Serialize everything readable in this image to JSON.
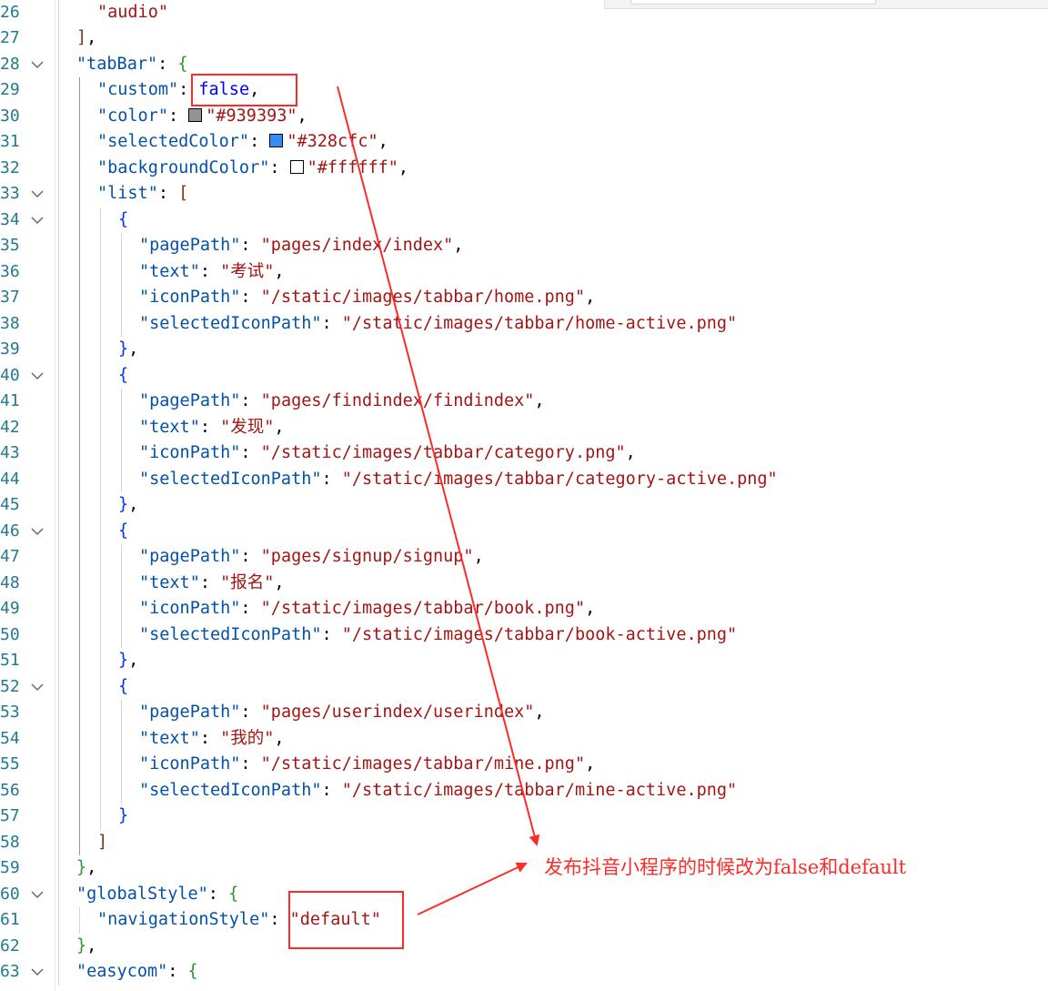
{
  "editor": {
    "lines": [
      {
        "number": "26",
        "fold": false,
        "tokens": [
          {
            "t": "\"audio\"",
            "c": "str"
          }
        ]
      },
      {
        "number": "27",
        "fold": false,
        "tokens": [
          {
            "t": "]",
            "c": "br3"
          },
          {
            "t": ",",
            "c": "pun"
          }
        ]
      },
      {
        "number": "28",
        "fold": true,
        "tokens": [
          {
            "t": "\"tabBar\"",
            "c": "key"
          },
          {
            "t": ": ",
            "c": "pun"
          },
          {
            "t": "{",
            "c": "br1"
          }
        ]
      },
      {
        "number": "29",
        "fold": false,
        "tokens": [
          {
            "t": "\"custom\"",
            "c": "key"
          },
          {
            "t": ": ",
            "c": "pun"
          },
          {
            "t": "false",
            "c": "kw"
          },
          {
            "t": ",",
            "c": "pun"
          }
        ]
      },
      {
        "number": "30",
        "fold": false,
        "tokens": [
          {
            "t": "\"color\"",
            "c": "key"
          },
          {
            "t": ": ",
            "c": "pun"
          },
          {
            "swatch": "#939393"
          },
          {
            "t": "\"#939393\"",
            "c": "str"
          },
          {
            "t": ",",
            "c": "pun"
          }
        ]
      },
      {
        "number": "31",
        "fold": false,
        "tokens": [
          {
            "t": "\"selectedColor\"",
            "c": "key"
          },
          {
            "t": ": ",
            "c": "pun"
          },
          {
            "swatch": "#328cfc"
          },
          {
            "t": "\"#328cfc\"",
            "c": "str"
          },
          {
            "t": ",",
            "c": "pun"
          }
        ]
      },
      {
        "number": "32",
        "fold": false,
        "tokens": [
          {
            "t": "\"backgroundColor\"",
            "c": "key"
          },
          {
            "t": ": ",
            "c": "pun"
          },
          {
            "swatch": "#ffffff"
          },
          {
            "t": "\"#ffffff\"",
            "c": "str"
          },
          {
            "t": ",",
            "c": "pun"
          }
        ]
      },
      {
        "number": "33",
        "fold": true,
        "tokens": [
          {
            "t": "\"list\"",
            "c": "key"
          },
          {
            "t": ": ",
            "c": "pun"
          },
          {
            "t": "[",
            "c": "br3"
          }
        ]
      },
      {
        "number": "34",
        "fold": true,
        "tokens": [
          {
            "t": "{",
            "c": "br2"
          }
        ]
      },
      {
        "number": "35",
        "fold": false,
        "tokens": [
          {
            "t": "\"pagePath\"",
            "c": "key"
          },
          {
            "t": ": ",
            "c": "pun"
          },
          {
            "t": "\"pages/index/index\"",
            "c": "str"
          },
          {
            "t": ",",
            "c": "pun"
          }
        ]
      },
      {
        "number": "36",
        "fold": false,
        "tokens": [
          {
            "t": "\"text\"",
            "c": "key"
          },
          {
            "t": ": ",
            "c": "pun"
          },
          {
            "t": "\"考试\"",
            "c": "str"
          },
          {
            "t": ",",
            "c": "pun"
          }
        ]
      },
      {
        "number": "37",
        "fold": false,
        "tokens": [
          {
            "t": "\"iconPath\"",
            "c": "key"
          },
          {
            "t": ": ",
            "c": "pun"
          },
          {
            "t": "\"/static/images/tabbar/home.png\"",
            "c": "str"
          },
          {
            "t": ",",
            "c": "pun"
          }
        ]
      },
      {
        "number": "38",
        "fold": false,
        "tokens": [
          {
            "t": "\"selectedIconPath\"",
            "c": "key"
          },
          {
            "t": ": ",
            "c": "pun"
          },
          {
            "t": "\"/static/images/tabbar/home-active.png\"",
            "c": "str"
          }
        ]
      },
      {
        "number": "39",
        "fold": false,
        "tokens": [
          {
            "t": "}",
            "c": "br2"
          },
          {
            "t": ",",
            "c": "pun"
          }
        ]
      },
      {
        "number": "40",
        "fold": true,
        "tokens": [
          {
            "t": "{",
            "c": "br2"
          }
        ]
      },
      {
        "number": "41",
        "fold": false,
        "tokens": [
          {
            "t": "\"pagePath\"",
            "c": "key"
          },
          {
            "t": ": ",
            "c": "pun"
          },
          {
            "t": "\"pages/findindex/findindex\"",
            "c": "str"
          },
          {
            "t": ",",
            "c": "pun"
          }
        ]
      },
      {
        "number": "42",
        "fold": false,
        "tokens": [
          {
            "t": "\"text\"",
            "c": "key"
          },
          {
            "t": ": ",
            "c": "pun"
          },
          {
            "t": "\"发现\"",
            "c": "str"
          },
          {
            "t": ",",
            "c": "pun"
          }
        ]
      },
      {
        "number": "43",
        "fold": false,
        "tokens": [
          {
            "t": "\"iconPath\"",
            "c": "key"
          },
          {
            "t": ": ",
            "c": "pun"
          },
          {
            "t": "\"/static/images/tabbar/category.png\"",
            "c": "str"
          },
          {
            "t": ",",
            "c": "pun"
          }
        ]
      },
      {
        "number": "44",
        "fold": false,
        "tokens": [
          {
            "t": "\"selectedIconPath\"",
            "c": "key"
          },
          {
            "t": ": ",
            "c": "pun"
          },
          {
            "t": "\"/static/images/tabbar/category-active.png\"",
            "c": "str"
          }
        ]
      },
      {
        "number": "45",
        "fold": false,
        "tokens": [
          {
            "t": "}",
            "c": "br2"
          },
          {
            "t": ",",
            "c": "pun"
          }
        ]
      },
      {
        "number": "46",
        "fold": true,
        "tokens": [
          {
            "t": "{",
            "c": "br2"
          }
        ]
      },
      {
        "number": "47",
        "fold": false,
        "tokens": [
          {
            "t": "\"pagePath\"",
            "c": "key"
          },
          {
            "t": ": ",
            "c": "pun"
          },
          {
            "t": "\"pages/signup/signup\"",
            "c": "str"
          },
          {
            "t": ",",
            "c": "pun"
          }
        ]
      },
      {
        "number": "48",
        "fold": false,
        "tokens": [
          {
            "t": "\"text\"",
            "c": "key"
          },
          {
            "t": ": ",
            "c": "pun"
          },
          {
            "t": "\"报名\"",
            "c": "str"
          },
          {
            "t": ",",
            "c": "pun"
          }
        ]
      },
      {
        "number": "49",
        "fold": false,
        "tokens": [
          {
            "t": "\"iconPath\"",
            "c": "key"
          },
          {
            "t": ": ",
            "c": "pun"
          },
          {
            "t": "\"/static/images/tabbar/book.png\"",
            "c": "str"
          },
          {
            "t": ",",
            "c": "pun"
          }
        ]
      },
      {
        "number": "50",
        "fold": false,
        "tokens": [
          {
            "t": "\"selectedIconPath\"",
            "c": "key"
          },
          {
            "t": ": ",
            "c": "pun"
          },
          {
            "t": "\"/static/images/tabbar/book-active.png\"",
            "c": "str"
          }
        ]
      },
      {
        "number": "51",
        "fold": false,
        "tokens": [
          {
            "t": "}",
            "c": "br2"
          },
          {
            "t": ",",
            "c": "pun"
          }
        ]
      },
      {
        "number": "52",
        "fold": true,
        "tokens": [
          {
            "t": "{",
            "c": "br2"
          }
        ]
      },
      {
        "number": "53",
        "fold": false,
        "tokens": [
          {
            "t": "\"pagePath\"",
            "c": "key"
          },
          {
            "t": ": ",
            "c": "pun"
          },
          {
            "t": "\"pages/userindex/userindex\"",
            "c": "str"
          },
          {
            "t": ",",
            "c": "pun"
          }
        ]
      },
      {
        "number": "54",
        "fold": false,
        "tokens": [
          {
            "t": "\"text\"",
            "c": "key"
          },
          {
            "t": ": ",
            "c": "pun"
          },
          {
            "t": "\"我的\"",
            "c": "str"
          },
          {
            "t": ",",
            "c": "pun"
          }
        ]
      },
      {
        "number": "55",
        "fold": false,
        "tokens": [
          {
            "t": "\"iconPath\"",
            "c": "key"
          },
          {
            "t": ": ",
            "c": "pun"
          },
          {
            "t": "\"/static/images/tabbar/mine.png\"",
            "c": "str"
          },
          {
            "t": ",",
            "c": "pun"
          }
        ]
      },
      {
        "number": "56",
        "fold": false,
        "tokens": [
          {
            "t": "\"selectedIconPath\"",
            "c": "key"
          },
          {
            "t": ": ",
            "c": "pun"
          },
          {
            "t": "\"/static/images/tabbar/mine-active.png\"",
            "c": "str"
          }
        ]
      },
      {
        "number": "57",
        "fold": false,
        "tokens": [
          {
            "t": "}",
            "c": "br2"
          }
        ]
      },
      {
        "number": "58",
        "fold": false,
        "tokens": [
          {
            "t": "]",
            "c": "br3"
          }
        ]
      },
      {
        "number": "59",
        "fold": false,
        "tokens": [
          {
            "t": "}",
            "c": "br1"
          },
          {
            "t": ",",
            "c": "pun"
          }
        ]
      },
      {
        "number": "60",
        "fold": true,
        "tokens": [
          {
            "t": "\"globalStyle\"",
            "c": "key"
          },
          {
            "t": ": ",
            "c": "pun"
          },
          {
            "t": "{",
            "c": "br1"
          }
        ]
      },
      {
        "number": "61",
        "fold": false,
        "tokens": [
          {
            "t": "\"navigationStyle\"",
            "c": "key"
          },
          {
            "t": ": ",
            "c": "pun"
          },
          {
            "t": "\"default\"",
            "c": "str"
          }
        ]
      },
      {
        "number": "62",
        "fold": false,
        "tokens": [
          {
            "t": "}",
            "c": "br1"
          },
          {
            "t": ",",
            "c": "pun"
          }
        ]
      },
      {
        "number": "63",
        "fold": true,
        "tokens": [
          {
            "t": "\"easycom\"",
            "c": "key"
          },
          {
            "t": ": ",
            "c": "pun"
          },
          {
            "t": "{",
            "c": "br1"
          }
        ]
      }
    ]
  },
  "annotation": {
    "text": "发布抖音小程序的时候改为false和default",
    "color": "#ff2a2a"
  },
  "colors": {
    "line_number": "#237893",
    "key": "#0451a5",
    "string": "#a31515",
    "keyword": "#0000ff"
  }
}
